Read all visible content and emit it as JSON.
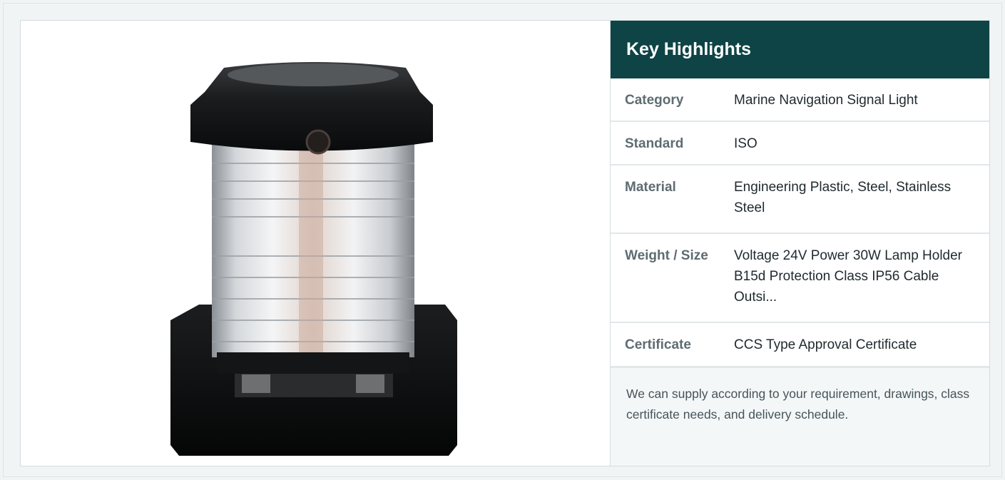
{
  "highlights": {
    "title": "Key Highlights",
    "rows": [
      {
        "label": "Category",
        "value": "Marine Navigation Signal Light"
      },
      {
        "label": "Standard",
        "value": "ISO"
      },
      {
        "label": "Material",
        "value": "Engineering Plastic, Steel, Stainless Steel"
      },
      {
        "label": "Weight / Size",
        "value": "Voltage 24V Power 30W Lamp Holder B15d Protection Class IP56 Cable Outsi..."
      },
      {
        "label": "Certificate",
        "value": "CCS Type Approval Certificate"
      }
    ],
    "note": "We can supply according to your requirement, drawings, class certificate needs, and delivery schedule."
  },
  "colors": {
    "header_bg": "#0e4446",
    "label": "#5e6c72",
    "value": "#1f2a2e"
  }
}
